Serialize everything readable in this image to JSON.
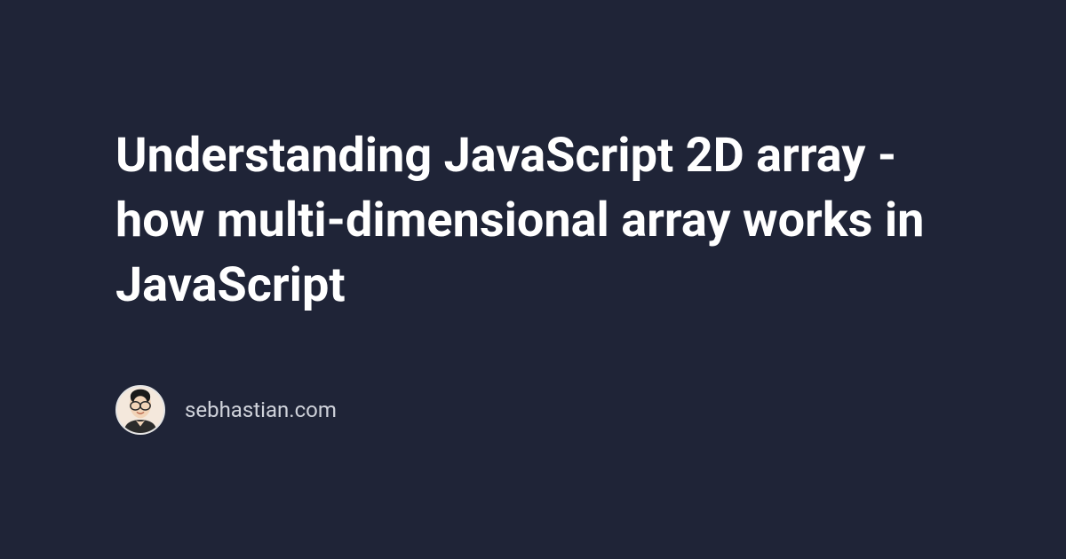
{
  "title": "Understanding JavaScript 2D array - how multi-dimensional array works in JavaScript",
  "author": {
    "site": "sebhastian.com"
  }
}
